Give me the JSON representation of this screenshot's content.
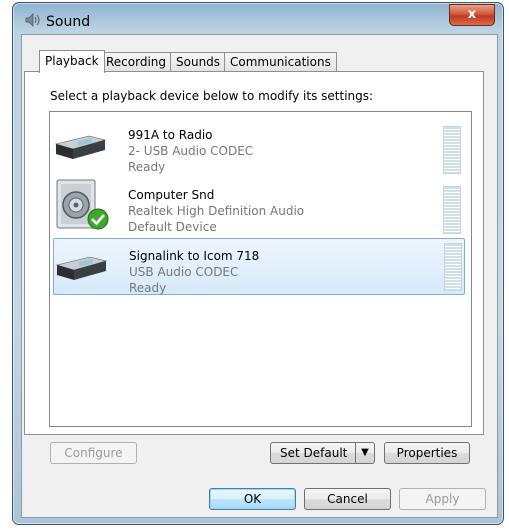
{
  "window": {
    "title": "Sound",
    "close_glyph": "x"
  },
  "tabs": [
    {
      "label": "Playback",
      "active": true
    },
    {
      "label": "Recording",
      "active": false
    },
    {
      "label": "Sounds",
      "active": false
    },
    {
      "label": "Communications",
      "active": false
    }
  ],
  "instruction": "Select a playback device below to modify its settings:",
  "devices": [
    {
      "name": "991A to Radio",
      "description": "2- USB Audio CODEC",
      "status": "Ready",
      "icon": "usb-audio-device-icon",
      "selected": false
    },
    {
      "name": "Computer Snd",
      "description": "Realtek High Definition Audio",
      "status": "Default Device",
      "icon": "speaker-icon",
      "selected": false,
      "default_check": true
    },
    {
      "name": "Signalink to Icom 718",
      "description": "USB Audio CODEC",
      "status": "Ready",
      "icon": "usb-audio-device-icon",
      "selected": true
    }
  ],
  "buttons": {
    "configure": "Configure",
    "set_default": "Set Default",
    "properties": "Properties",
    "ok": "OK",
    "cancel": "Cancel",
    "apply": "Apply"
  },
  "colors": {
    "selection": "#d5e9f9",
    "selection_border": "#84acdd",
    "close": "#c0391b"
  }
}
